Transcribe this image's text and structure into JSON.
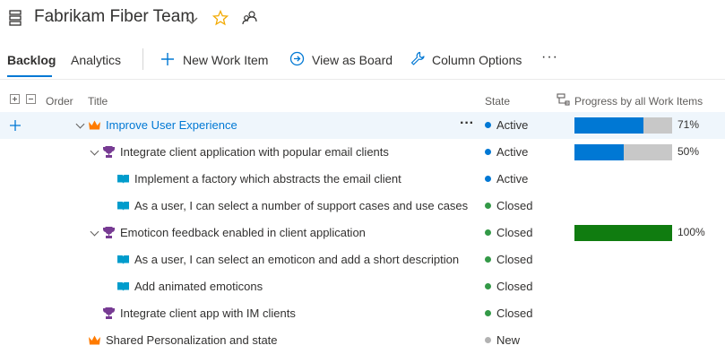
{
  "header": {
    "team_name": "Fabrikam Fiber Team"
  },
  "toolbar": {
    "tabs": [
      {
        "label": "Backlog",
        "active": true
      },
      {
        "label": "Analytics",
        "active": false
      }
    ],
    "new_work_item": "New Work Item",
    "view_as_board": "View as Board",
    "column_options": "Column Options",
    "more": "···"
  },
  "columns": {
    "order": "Order",
    "title": "Title",
    "state": "State",
    "progress": "Progress by all Work Items"
  },
  "colors": {
    "accent": "#0078d4",
    "active": "#0078d4",
    "closed": "#339947",
    "new": "#b2b2b2",
    "progress_blue": "#0078d4",
    "progress_green": "#107c10",
    "feature": "#773b93",
    "epic": "#ff7b00",
    "story": "#009ccc"
  },
  "rows": [
    {
      "title": "Improve User Experience",
      "type": "epic",
      "state": "Active",
      "progress": 0.71,
      "progress_label": "71%"
    },
    {
      "title": "Integrate client application with popular email clients",
      "type": "feature",
      "state": "Active",
      "progress": 0.5,
      "progress_label": "50%"
    },
    {
      "title": "Implement a factory which abstracts the email client",
      "type": "story",
      "state": "Active"
    },
    {
      "title": "As a user, I can select a number of support cases and use cases",
      "type": "story",
      "state": "Closed"
    },
    {
      "title": "Emoticon feedback enabled in client application",
      "type": "feature",
      "state": "Closed",
      "progress": 1.0,
      "progress_label": "100%"
    },
    {
      "title": "As a user, I can select an emoticon and add a short description",
      "type": "story",
      "state": "Closed"
    },
    {
      "title": "Add animated emoticons",
      "type": "story",
      "state": "Closed"
    },
    {
      "title": "Integrate client app with IM clients",
      "type": "feature",
      "state": "Closed"
    },
    {
      "title": "Shared Personalization and state",
      "type": "epic",
      "state": "New"
    }
  ]
}
